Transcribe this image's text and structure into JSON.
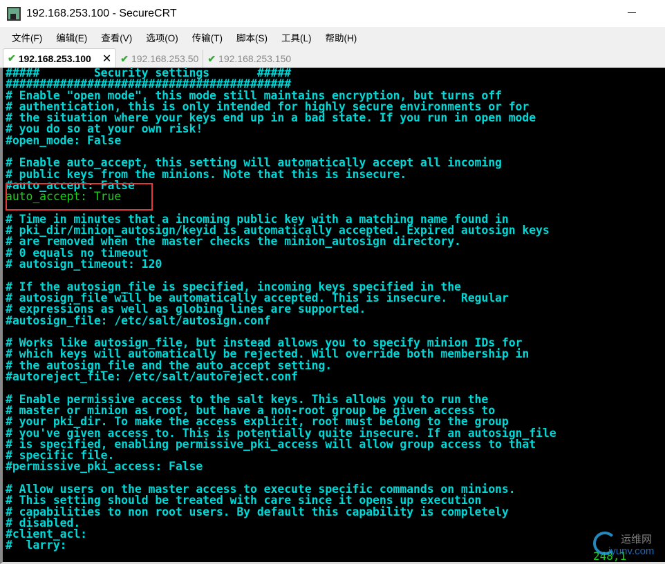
{
  "window": {
    "title": "192.168.253.100 - SecureCRT"
  },
  "menu": [
    "文件(F)",
    "编辑(E)",
    "查看(V)",
    "选项(O)",
    "传输(T)",
    "脚本(S)",
    "工具(L)",
    "帮助(H)"
  ],
  "tabs": [
    {
      "label": "192.168.253.100",
      "active": true
    },
    {
      "label": "192.168.253.50"
    },
    {
      "label": "192.168.253.150"
    }
  ],
  "terminal": {
    "lines": [
      "#####        Security settings       #####",
      "##########################################",
      "# Enable \"open mode\", this mode still maintains encryption, but turns off",
      "# authentication, this is only intended for highly secure environments or for",
      "# the situation where your keys end up in a bad state. If you run in open mode",
      "# you do so at your own risk!",
      "#open_mode: False",
      "",
      "# Enable auto_accept, this setting will automatically accept all incoming",
      "# public keys from the minions. Note that this is insecure.",
      "#auto_accept: False",
      "auto_accept: True",
      "",
      "# Time in minutes that a incoming public key with a matching name found in",
      "# pki_dir/minion_autosign/keyid is automatically accepted. Expired autosign keys",
      "# are removed when the master checks the minion_autosign directory.",
      "# 0 equals no timeout",
      "# autosign_timeout: 120",
      "",
      "# If the autosign_file is specified, incoming keys specified in the",
      "# autosign_file will be automatically accepted. This is insecure.  Regular",
      "# expressions as well as globing lines are supported.",
      "#autosign_file: /etc/salt/autosign.conf",
      "",
      "# Works like autosign_file, but instead allows you to specify minion IDs for",
      "# which keys will automatically be rejected. Will override both membership in",
      "# the autosign_file and the auto_accept setting.",
      "#autoreject_file: /etc/salt/autoreject.conf",
      "",
      "# Enable permissive access to the salt keys. This allows you to run the",
      "# master or minion as root, but have a non-root group be given access to",
      "# your pki_dir. To make the access explicit, root must belong to the group",
      "# you've given access to. This is potentially quite insecure. If an autosign_file",
      "# is specified, enabling permissive_pki_access will allow group access to that",
      "# specific file.",
      "#permissive_pki_access: False",
      "",
      "# Allow users on the master access to execute specific commands on minions.",
      "# This setting should be treated with care since it opens up execution",
      "# capabilities to non root users. By default this capability is completely",
      "# disabled.",
      "#client_acl:",
      "#  larry:"
    ],
    "highlighted_line": 11,
    "cursor_position": "248,1"
  },
  "watermark": {
    "cn": "运维网",
    "en": "iyunv.com"
  }
}
